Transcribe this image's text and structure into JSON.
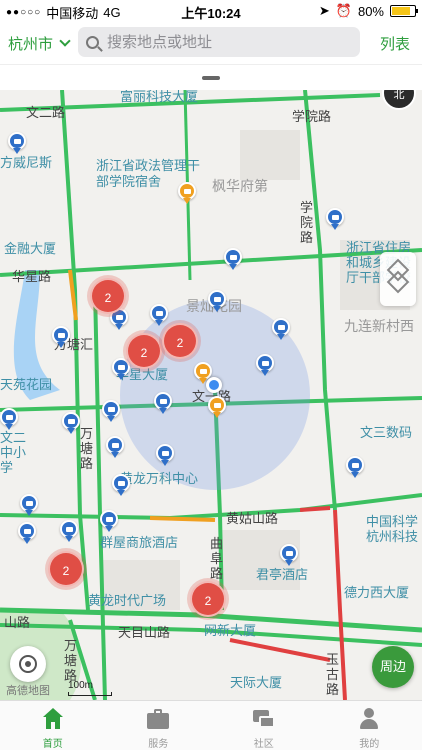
{
  "status_bar": {
    "carrier": "中国移动",
    "network": "4G",
    "time": "上午10:24",
    "battery": "80%"
  },
  "header": {
    "city": "杭州市",
    "search_placeholder": "搜索地点或地址",
    "list_label": "列表"
  },
  "map": {
    "compass_label": "北",
    "scale_label": "100m",
    "nearby_label": "周边",
    "watermark": "高德地图",
    "clusters": [
      "2",
      "2",
      "2",
      "2",
      "2"
    ],
    "labels": {
      "road_wener": "文二路",
      "road_xueyuan": "学院路",
      "road_xueyuan2": "学院路",
      "poi_fumei": "富丽科技大厦",
      "poi_weinisi": "方威尼斯",
      "poi_zhengfa": "浙江省政法管理干部学院宿舍",
      "area_fenghua": "枫华府第",
      "poi_jinrong": "金融大厦",
      "road_huaxing": "华星路",
      "poi_jianshe": "浙江省住房和城乡建设厅干部学校",
      "area_jiulian": "九连新村西",
      "poi_xiyuan": "景灿花园",
      "road_tanghui": "万塘汇",
      "poi_huaxing": "华星大厦",
      "poi_tianyuan": "天苑花园",
      "road_wenyi": "文一路",
      "road_wantang": "万塘路",
      "poi_school": "文二中小学",
      "poi_shuma": "文三数码",
      "poi_wanke": "黄龙万科中心",
      "road_huanggushan": "黄姑山路",
      "poi_kexue": "中国科学杭州科技",
      "poi_qunwu": "群屋商旅酒店",
      "road_qufu": "曲阜路",
      "poi_juntin": "君亭酒店",
      "poi_huanglong": "黄龙时代广场",
      "poi_deli": "德力西大厦",
      "road_shan": "山路",
      "road_tianmu": "天目山路",
      "poi_wangxin": "网新大厦",
      "road_wantang2": "万塘路",
      "poi_tianji": "天际大厦",
      "road_yugu": "玉古路"
    }
  },
  "tabs": [
    {
      "label": "首页",
      "icon": "home-icon",
      "active": true
    },
    {
      "label": "服务",
      "icon": "briefcase-icon",
      "active": false
    },
    {
      "label": "社区",
      "icon": "chat-icon",
      "active": false
    },
    {
      "label": "我的",
      "icon": "user-icon",
      "active": false
    }
  ],
  "colors": {
    "accent": "#2e9e3e",
    "cluster": "#e04e45",
    "pin": "#2f6fc8",
    "road_green": "#3cc060",
    "road_red": "#e04040"
  }
}
